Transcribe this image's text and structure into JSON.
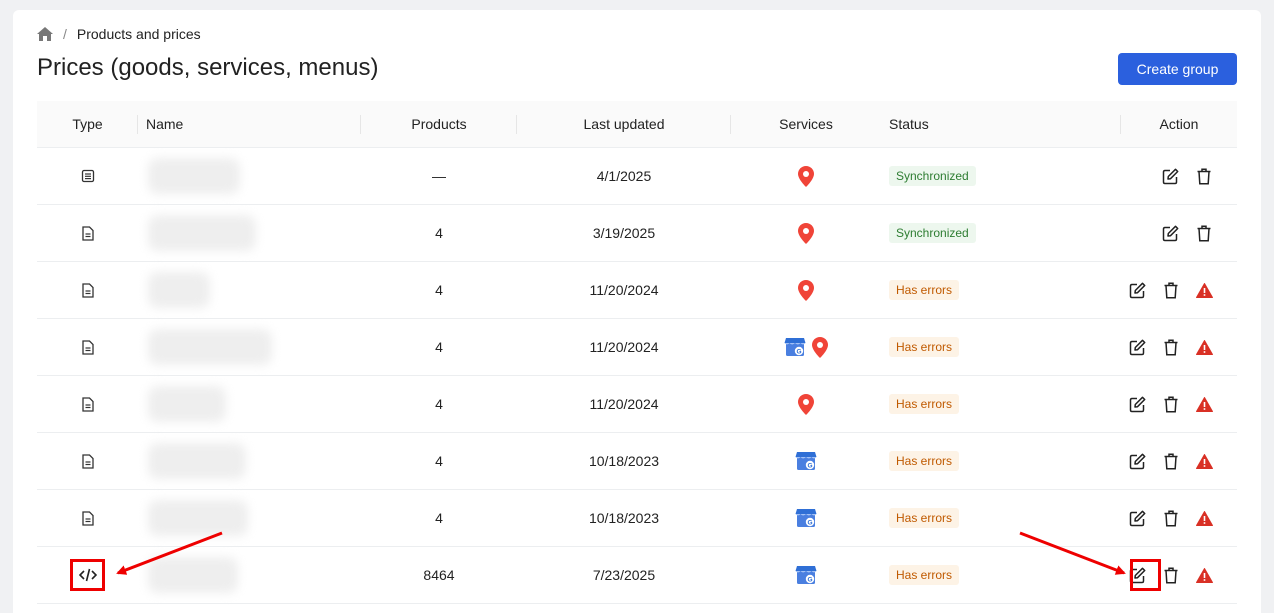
{
  "breadcrumb": {
    "home_icon": "home-icon",
    "separator": "/",
    "current": "Products and prices"
  },
  "page": {
    "title": "Prices (goods, services, menus)",
    "create_button": "Create group"
  },
  "table": {
    "headers": {
      "type": "Type",
      "name": "Name",
      "products": "Products",
      "last_updated": "Last updated",
      "services": "Services",
      "status": "Status",
      "action": "Action"
    },
    "rows": [
      {
        "type_icon": "list-document-icon",
        "products": "—",
        "last_updated": "4/1/2025",
        "services": [
          "map-pin"
        ],
        "status": "Synchronized",
        "status_kind": "ok",
        "warning": false
      },
      {
        "type_icon": "document-icon",
        "products": "4",
        "last_updated": "3/19/2025",
        "services": [
          "map-pin"
        ],
        "status": "Synchronized",
        "status_kind": "ok",
        "warning": false
      },
      {
        "type_icon": "document-icon",
        "products": "4",
        "last_updated": "11/20/2024",
        "services": [
          "map-pin"
        ],
        "status": "Has errors",
        "status_kind": "err",
        "warning": true
      },
      {
        "type_icon": "document-icon",
        "products": "4",
        "last_updated": "11/20/2024",
        "services": [
          "google-business",
          "map-pin"
        ],
        "status": "Has errors",
        "status_kind": "err",
        "warning": true
      },
      {
        "type_icon": "document-icon",
        "products": "4",
        "last_updated": "11/20/2024",
        "services": [
          "map-pin"
        ],
        "status": "Has errors",
        "status_kind": "err",
        "warning": true
      },
      {
        "type_icon": "document-icon",
        "products": "4",
        "last_updated": "10/18/2023",
        "services": [
          "google-business"
        ],
        "status": "Has errors",
        "status_kind": "err",
        "warning": true
      },
      {
        "type_icon": "document-icon",
        "products": "4",
        "last_updated": "10/18/2023",
        "services": [
          "google-business"
        ],
        "status": "Has errors",
        "status_kind": "err",
        "warning": true
      },
      {
        "type_icon": "code-icon",
        "products": "8464",
        "last_updated": "7/23/2025",
        "services": [
          "google-business"
        ],
        "status": "Has errors",
        "status_kind": "err",
        "warning": true
      }
    ]
  },
  "colors": {
    "primary": "#2b60de",
    "pin": "#f04438",
    "gmb_blue": "#4a7fe0",
    "ok_text": "#2e7d32",
    "err_text": "#c05a00",
    "warning": "#d93025",
    "annotation": "#e00000"
  }
}
